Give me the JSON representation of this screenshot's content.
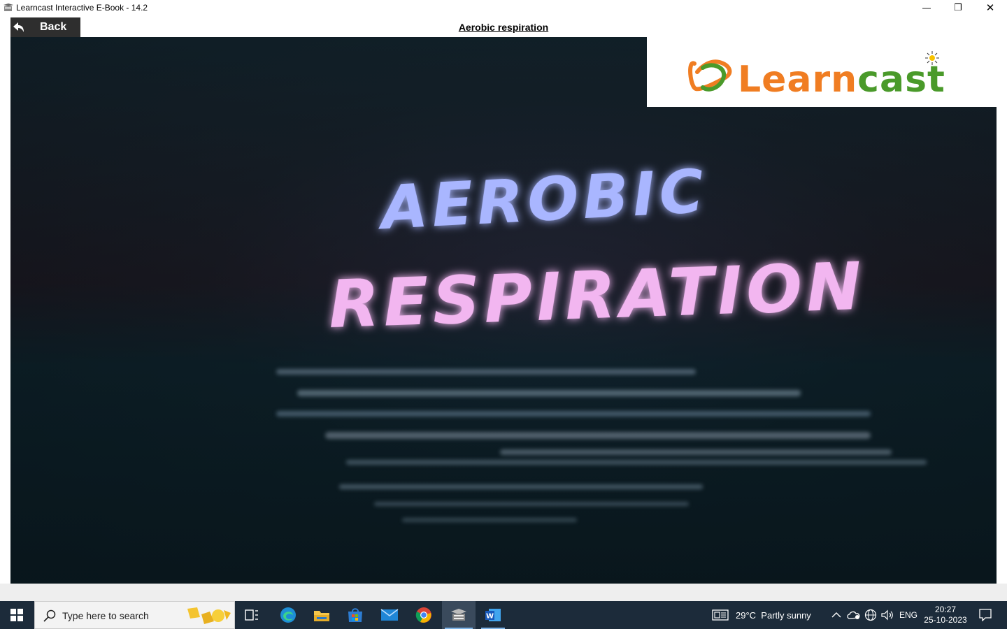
{
  "window": {
    "title": "Learncast Interactive E-Book - 14.2",
    "minimize_glyph": "—",
    "maximize_glyph": "❐",
    "close_glyph": "✕"
  },
  "header": {
    "back_label": "Back",
    "page_title": "Aerobic respiration"
  },
  "video": {
    "title_line1": "AEROBIC",
    "title_line2": "RESPIRATION",
    "logo_text": "Learncast",
    "logo_colors": {
      "orange": "#f07d22",
      "green": "#4a9a2a"
    }
  },
  "taskbar": {
    "search_placeholder": "Type here to search",
    "weather": "29°C  Partly sunny",
    "language": "ENG",
    "time": "20:27",
    "date": "25-10-2023",
    "apps": [
      "task-view",
      "edge",
      "file-explorer",
      "microsoft-store",
      "mail",
      "chrome",
      "learncast",
      "word"
    ]
  }
}
